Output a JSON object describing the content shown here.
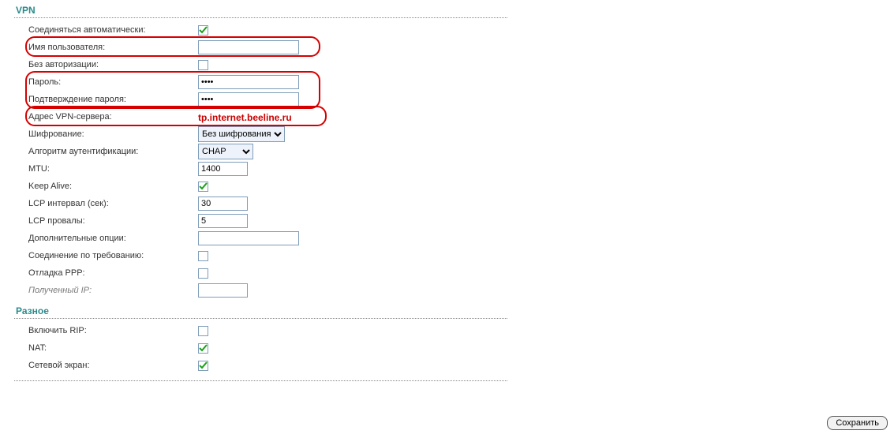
{
  "sections": {
    "vpn": {
      "title": "VPN"
    },
    "misc": {
      "title": "Разное"
    }
  },
  "rows": {
    "autoConnect": {
      "label": "Соединяться автоматически:"
    },
    "username": {
      "label": "Имя пользователя:",
      "value": ""
    },
    "noAuth": {
      "label": "Без авторизации:"
    },
    "password": {
      "label": "Пароль:",
      "value": "••••"
    },
    "passwordConf": {
      "label": "Подтверждение пароля:",
      "value": "••••"
    },
    "vpnServer": {
      "label": "Адрес VPN-сервера:",
      "value": "tp.internet.beeline.ru"
    },
    "encryption": {
      "label": "Шифрование:",
      "selected": "Без шифрования"
    },
    "authAlgo": {
      "label": "Алгоритм аутентификации:",
      "selected": "CHAP"
    },
    "mtu": {
      "label": "MTU:",
      "value": "1400"
    },
    "keepAlive": {
      "label": "Keep Alive:"
    },
    "lcpInterval": {
      "label": "LCP интервал (сек):",
      "value": "30"
    },
    "lcpFails": {
      "label": "LCP провалы:",
      "value": "5"
    },
    "extraOpts": {
      "label": "Дополнительные опции:",
      "value": ""
    },
    "onDemand": {
      "label": "Соединение по требованию:"
    },
    "pppDebug": {
      "label": "Отладка PPP:"
    },
    "receivedIp": {
      "label": "Полученный IP:",
      "value": ""
    },
    "rip": {
      "label": "Включить RIP:"
    },
    "nat": {
      "label": "NAT:"
    },
    "firewall": {
      "label": "Сетевой экран:"
    }
  },
  "buttons": {
    "save": "Сохранить"
  }
}
